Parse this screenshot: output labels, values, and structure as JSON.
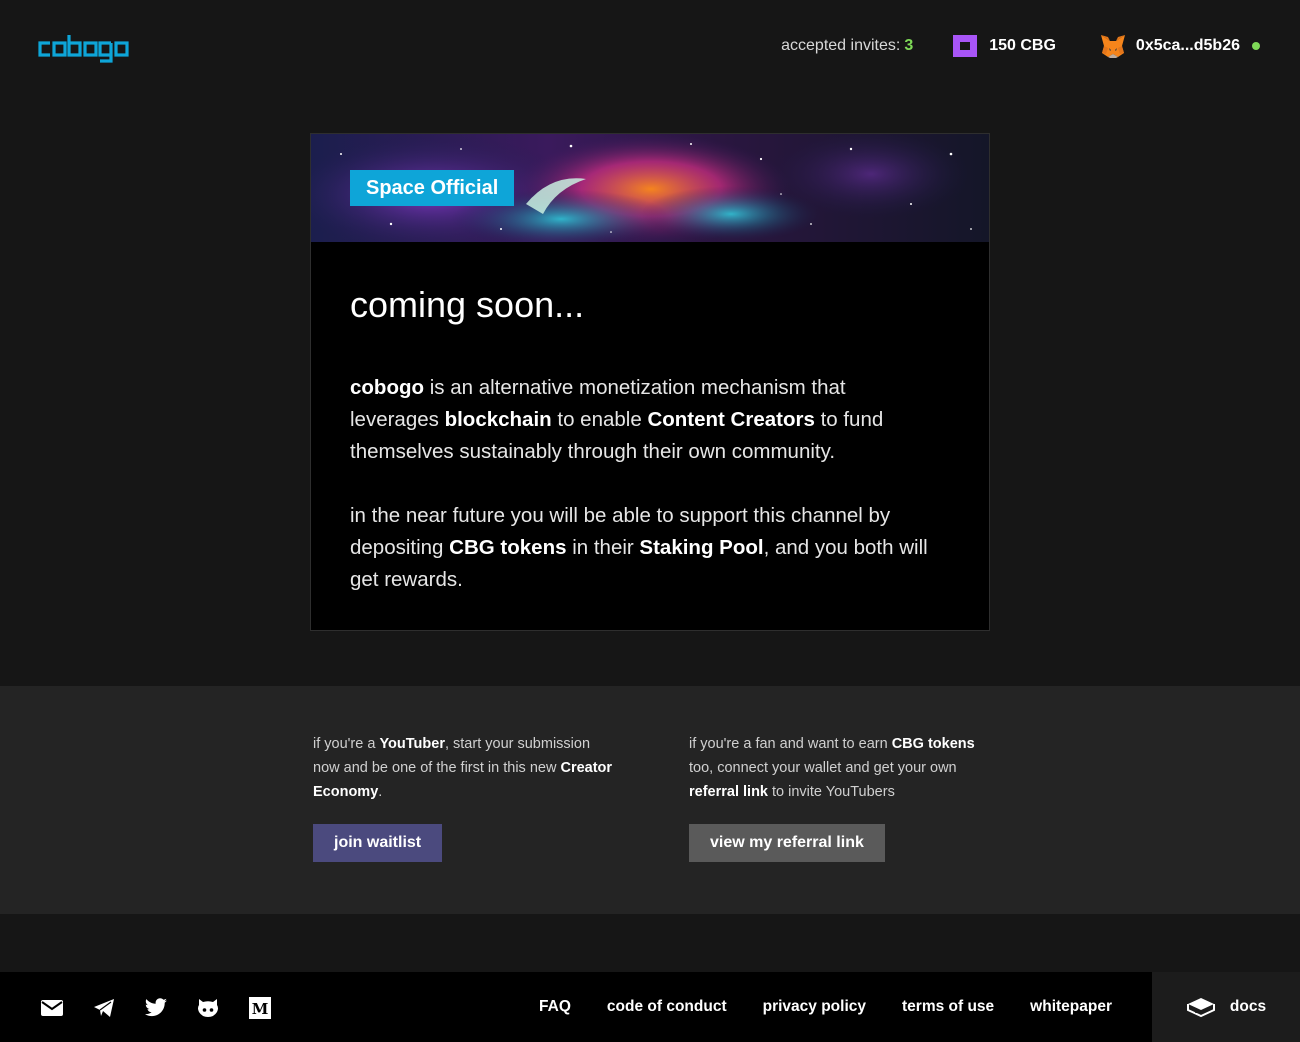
{
  "header": {
    "logo_text": "cobogo",
    "invites_label": "accepted invites:",
    "invites_count": "3",
    "token_balance": "150 CBG",
    "wallet_address": "0x5ca...d5b26",
    "status_color": "#7ed957",
    "token_icon": "cbg-token-icon",
    "wallet_icon": "metamask-fox-icon"
  },
  "card": {
    "banner_label": "Space Official",
    "title": "coming soon...",
    "para1": [
      {
        "t": "cobogo",
        "b": true
      },
      {
        "t": " is an alternative monetization mechanism that leverages ",
        "b": false
      },
      {
        "t": "blockchain",
        "b": true
      },
      {
        "t": " to enable ",
        "b": false
      },
      {
        "t": "Content Creators",
        "b": true
      },
      {
        "t": " to fund themselves sustainably through their own community.",
        "b": false
      }
    ],
    "para2": [
      {
        "t": "in the near future you will be able to support this channel by depositing ",
        "b": false
      },
      {
        "t": "CBG tokens",
        "b": true
      },
      {
        "t": " in their ",
        "b": false
      },
      {
        "t": "Staking Pool",
        "b": true
      },
      {
        "t": ", and you both will get rewards.",
        "b": false
      }
    ]
  },
  "cta": {
    "left_text": [
      {
        "t": "if you're a ",
        "b": false
      },
      {
        "t": "YouTuber",
        "b": true
      },
      {
        "t": ", start your submission now and be one of the first in this new ",
        "b": false
      },
      {
        "t": "Creator Economy",
        "b": true
      },
      {
        "t": ".",
        "b": false
      }
    ],
    "left_button": "join waitlist",
    "right_text": [
      {
        "t": "if you're a fan and want to earn ",
        "b": false
      },
      {
        "t": "CBG tokens",
        "b": true
      },
      {
        "t": " too, connect your wallet and get your own ",
        "b": false
      },
      {
        "t": "referral link",
        "b": true
      },
      {
        "t": " to invite YouTubers",
        "b": false
      }
    ],
    "right_button": "view my referral link",
    "colors": {
      "waitlist": "#4b4a7e",
      "referral": "#5a5a5a"
    }
  },
  "footer": {
    "social_icons": [
      "email-icon",
      "telegram-icon",
      "twitter-icon",
      "github-icon",
      "medium-icon"
    ],
    "links": [
      "FAQ",
      "code of conduct",
      "privacy policy",
      "terms of use",
      "whitepaper"
    ],
    "docs_label": "docs"
  },
  "colors": {
    "accent": "#0ea5d8",
    "background": "#161616",
    "token": "#a855f7"
  }
}
